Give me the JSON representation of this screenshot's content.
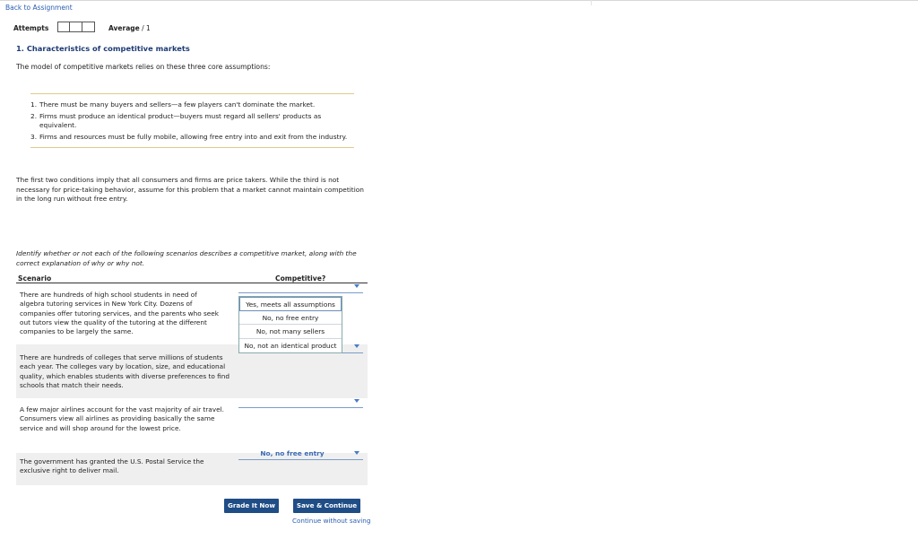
{
  "nav": {
    "back_label": "Back to Assignment"
  },
  "attempts": {
    "label": "Attempts",
    "box_count": 3
  },
  "average": {
    "label": "Average",
    "value": "/ 1"
  },
  "question": {
    "title": "1. Characteristics of competitive markets",
    "intro": "The model of competitive markets relies on these three core assumptions:",
    "assumptions": [
      {
        "num": "1.",
        "text": "There must be many buyers and sellers—a few players can't dominate the market."
      },
      {
        "num": "2.",
        "text": "Firms must produce an identical product—buyers must regard all sellers' products as equivalent."
      },
      {
        "num": "3.",
        "text": "Firms and resources must be fully mobile, allowing free entry into and exit from the industry."
      }
    ],
    "paragraph": "The first two conditions imply that all consumers and firms are price takers. While the third is not necessary for price-taking behavior, assume for this problem that a market cannot maintain competition in the long run without free entry.",
    "instruction": "Identify whether or not each of the following scenarios describes a competitive market, along with the correct explanation of why or why not."
  },
  "table": {
    "headers": {
      "scenario": "Scenario",
      "competitive": "Competitive?"
    },
    "rows": [
      {
        "scenario": "There are hundreds of high school students in need of algebra tutoring services in New York City. Dozens of companies offer tutoring services, and the parents who seek out tutors view the quality of the tutoring at the different companies to be largely the same.",
        "selected": ""
      },
      {
        "scenario": "There are hundreds of colleges that serve millions of students each year. The colleges vary by location, size, and educational quality, which enables students with diverse preferences to find schools that match their needs.",
        "selected": ""
      },
      {
        "scenario": "A few major airlines account for the vast majority of air travel. Consumers view all airlines as providing basically the same service and will shop around for the lowest price.",
        "selected": ""
      },
      {
        "scenario": "The government has granted the U.S. Postal Service the exclusive right to deliver mail.",
        "selected": "No, no free entry"
      }
    ]
  },
  "dropdown": {
    "options": [
      "Yes, meets all assumptions",
      "No, no free entry",
      "No, not many sellers",
      "No, not an identical product"
    ]
  },
  "buttons": {
    "grade": "Grade It Now",
    "save": "Save & Continue",
    "continue_link": "Continue without saving"
  },
  "colors": {
    "link": "#2a5db0",
    "title": "#1e3b73",
    "button": "#1f4d86",
    "rule": "#e3c98d"
  }
}
